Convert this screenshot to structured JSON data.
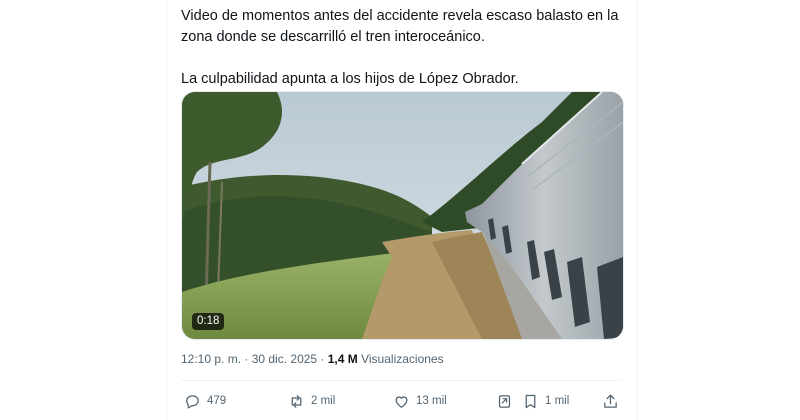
{
  "tweet": {
    "text_line1": "Video de momentos antes del accidente revela escaso balasto en la zona donde se descarrilló el tren interoceánico.",
    "text_line2": "La culpabilidad apunta a los hijos de López Obrador."
  },
  "video": {
    "duration": "0:18"
  },
  "meta": {
    "timestamp": "12:10 p. m. · 30 dic. 2025 · ",
    "views_count": "1,4 M",
    "views_label": " Visualizaciones"
  },
  "actions": {
    "replies": "479",
    "reposts": "2 mil",
    "likes": "13 mil",
    "bookmarks": "1 mil"
  },
  "icons": [
    "reply-icon",
    "repost-icon",
    "like-icon",
    "grok-icon",
    "bookmark-icon",
    "share-icon"
  ],
  "colors": {
    "icon": "#536471",
    "text": "#0f1419",
    "secondary": "#536471"
  }
}
